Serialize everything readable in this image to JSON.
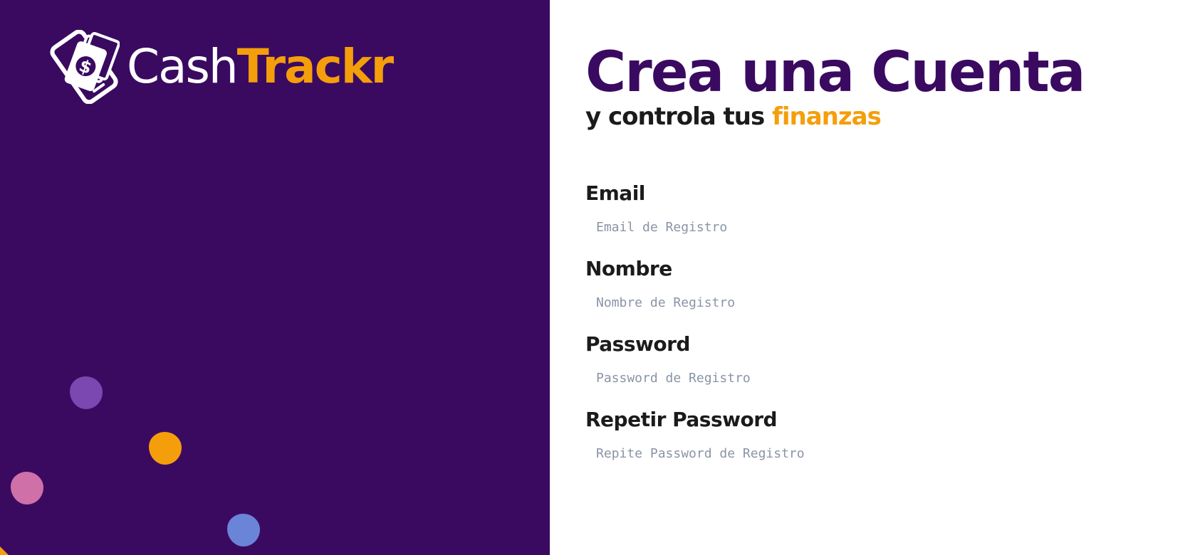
{
  "brand": {
    "name_part1": "Cash",
    "name_part2": "Trackr",
    "icon": "money-phone-icon",
    "colors": {
      "purple": "#3a0a61",
      "orange": "#f59e0b",
      "white": "#ffffff"
    }
  },
  "decorations": {
    "blobs": [
      {
        "name": "blob-violet",
        "color": "#7b47b0"
      },
      {
        "name": "blob-orange",
        "color": "#f59e0b"
      },
      {
        "name": "blob-pink",
        "color": "#d070a8"
      },
      {
        "name": "blob-blue",
        "color": "#6a84d8"
      }
    ]
  },
  "header": {
    "title": "Crea una Cuenta",
    "subtitle_prefix": "y controla tus",
    "subtitle_accent": "finanzas"
  },
  "form": {
    "email": {
      "label": "Email",
      "placeholder": "Email de Registro",
      "value": ""
    },
    "name": {
      "label": "Nombre",
      "placeholder": "Nombre de Registro",
      "value": ""
    },
    "password": {
      "label": "Password",
      "placeholder": "Password de Registro",
      "value": ""
    },
    "password_confirm": {
      "label": "Repetir Password",
      "placeholder": "Repite Password de Registro",
      "value": ""
    }
  }
}
